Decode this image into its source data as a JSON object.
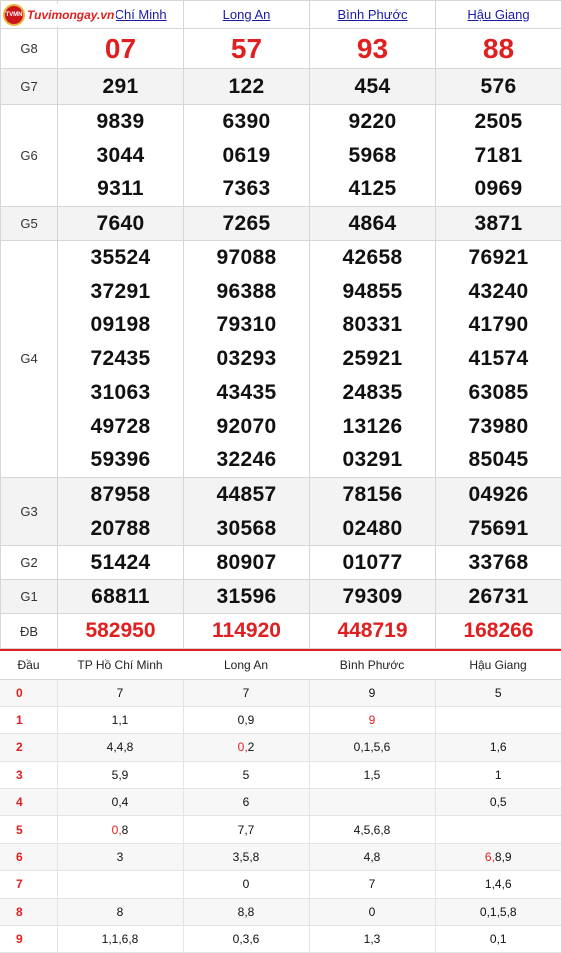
{
  "logo": {
    "text": "Tuvimongay.vn",
    "badge": "TVMN"
  },
  "provinces": [
    "TP Hồ Chí Minh",
    "Long An",
    "Bình Phước",
    "Hậu Giang"
  ],
  "prizes": [
    {
      "label": "G8",
      "values": [
        [
          "07"
        ],
        [
          "57"
        ],
        [
          "93"
        ],
        [
          "88"
        ]
      ]
    },
    {
      "label": "G7",
      "values": [
        [
          "291"
        ],
        [
          "122"
        ],
        [
          "454"
        ],
        [
          "576"
        ]
      ]
    },
    {
      "label": "G6",
      "values": [
        [
          "9839",
          "3044",
          "9311"
        ],
        [
          "6390",
          "0619",
          "7363"
        ],
        [
          "9220",
          "5968",
          "4125"
        ],
        [
          "2505",
          "7181",
          "0969"
        ]
      ]
    },
    {
      "label": "G5",
      "values": [
        [
          "7640"
        ],
        [
          "7265"
        ],
        [
          "4864"
        ],
        [
          "3871"
        ]
      ]
    },
    {
      "label": "G4",
      "values": [
        [
          "35524",
          "37291",
          "09198",
          "72435",
          "31063",
          "49728",
          "59396"
        ],
        [
          "97088",
          "96388",
          "79310",
          "03293",
          "43435",
          "92070",
          "32246"
        ],
        [
          "42658",
          "94855",
          "80331",
          "25921",
          "24835",
          "13126",
          "03291"
        ],
        [
          "76921",
          "43240",
          "41790",
          "41574",
          "63085",
          "73980",
          "85045"
        ]
      ]
    },
    {
      "label": "G3",
      "values": [
        [
          "87958",
          "20788"
        ],
        [
          "44857",
          "30568"
        ],
        [
          "78156",
          "02480"
        ],
        [
          "04926",
          "75691"
        ]
      ]
    },
    {
      "label": "G2",
      "values": [
        [
          "51424"
        ],
        [
          "80907"
        ],
        [
          "01077"
        ],
        [
          "33768"
        ]
      ]
    },
    {
      "label": "G1",
      "values": [
        [
          "68811"
        ],
        [
          "31596"
        ],
        [
          "79309"
        ],
        [
          "26731"
        ]
      ]
    },
    {
      "label": "ĐB",
      "values": [
        [
          "582950"
        ],
        [
          "114920"
        ],
        [
          "448719"
        ],
        [
          "168266"
        ]
      ]
    }
  ],
  "loto": {
    "head_label": "Đầu",
    "columns": [
      "TP Hồ Chí Minh",
      "Long An",
      "Bình Phước",
      "Hậu Giang"
    ],
    "rows": [
      {
        "head": "0",
        "cells": [
          "7",
          "7",
          "9",
          "5"
        ]
      },
      {
        "head": "1",
        "cells": [
          "1,1",
          "0,9",
          "9",
          ""
        ]
      },
      {
        "head": "2",
        "cells": [
          "4,4,8",
          "0,2",
          "0,1,5,6",
          "1,6"
        ]
      },
      {
        "head": "3",
        "cells": [
          "5,9",
          "5",
          "1,5",
          "1"
        ]
      },
      {
        "head": "4",
        "cells": [
          "0,4",
          "6",
          "",
          "0,5"
        ]
      },
      {
        "head": "5",
        "cells": [
          "0,8",
          "7,7",
          "4,5,6,8",
          ""
        ]
      },
      {
        "head": "6",
        "cells": [
          "3",
          "3,5,8",
          "4,8",
          "6,8,9"
        ]
      },
      {
        "head": "7",
        "cells": [
          "",
          "0",
          "7",
          "1,4,6"
        ]
      },
      {
        "head": "8",
        "cells": [
          "8",
          "8,8",
          "0",
          "0,1,5,8"
        ]
      },
      {
        "head": "9",
        "cells": [
          "1,1,6,8",
          "0,3,6",
          "1,3",
          "0,1"
        ]
      }
    ],
    "highlight": [
      {
        "row": 1,
        "col": 2,
        "index": 0
      },
      {
        "row": 2,
        "col": 1,
        "index": 0
      },
      {
        "row": 5,
        "col": 0,
        "index": 0
      },
      {
        "row": 6,
        "col": 3,
        "index": 0
      }
    ]
  },
  "colors": {
    "accent": "#e02020",
    "link": "#1a1aa6",
    "alt_row": "#f3f3f3"
  }
}
